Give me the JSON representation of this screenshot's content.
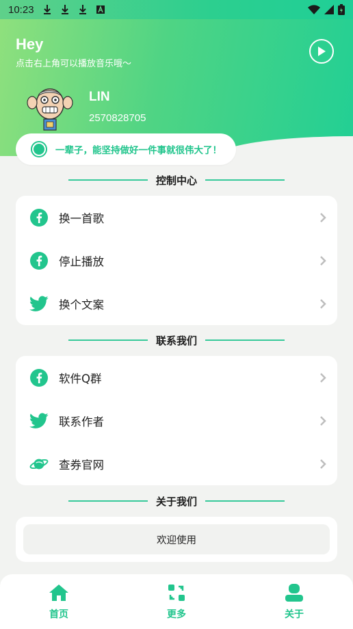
{
  "status_bar": {
    "time": "10:23",
    "icons": [
      "download-icon",
      "download-icon",
      "download-icon",
      "a-box-icon",
      "wifi-icon",
      "signal-icon",
      "battery-icon"
    ]
  },
  "header": {
    "greeting": "Hey",
    "subtitle": "点击右上角可以播放音乐哦～",
    "play_icon": "play-circle-icon",
    "user": {
      "name": "LIN",
      "id": "2570828705"
    },
    "motto": "一辈子，能坚持做好一件事就很伟大了！"
  },
  "sections": {
    "control": {
      "title": "控制中心",
      "items": [
        {
          "label": "换一首歌",
          "icon": "facebook-icon"
        },
        {
          "label": "停止播放",
          "icon": "facebook-icon"
        },
        {
          "label": "换个文案",
          "icon": "twitter-icon"
        }
      ]
    },
    "contact": {
      "title": "联系我们",
      "items": [
        {
          "label": "软件Q群",
          "icon": "facebook-icon"
        },
        {
          "label": "联系作者",
          "icon": "twitter-icon"
        },
        {
          "label": "查券官网",
          "icon": "planet-icon"
        }
      ]
    },
    "about": {
      "title": "关于我们",
      "button": "欢迎使用"
    }
  },
  "bottom_nav": [
    {
      "label": "首页",
      "icon": "home-icon"
    },
    {
      "label": "更多",
      "icon": "more-icon"
    },
    {
      "label": "关于",
      "icon": "user-icon"
    }
  ],
  "colors": {
    "accent": "#22c58d",
    "header_start": "#8fe07d",
    "header_end": "#22cf94",
    "background": "#f2f3f1"
  }
}
